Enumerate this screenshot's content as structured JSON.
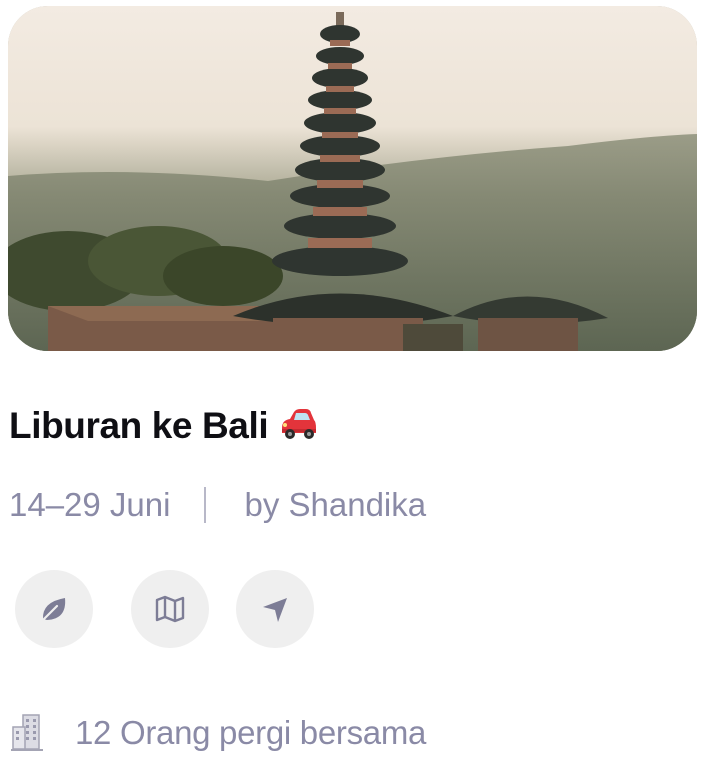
{
  "trip": {
    "image_icon": "bali-temple-photo",
    "title": "Liburan ke Bali",
    "title_emoji_icon": "car-icon",
    "dates": "14–29 Juni",
    "author": "by Shandika"
  },
  "actions": [
    {
      "icon": "leaf-icon"
    },
    {
      "icon": "map-icon"
    },
    {
      "icon": "navigation-icon"
    }
  ],
  "companions": {
    "icon": "building-icon",
    "text": "12 Orang pergi bersama"
  },
  "colors": {
    "title": "#0f0f14",
    "muted_text": "#8a8aa6",
    "action_bg": "#efefef",
    "icon_stroke": "#7d7d96",
    "car_red": "#e3343b"
  }
}
